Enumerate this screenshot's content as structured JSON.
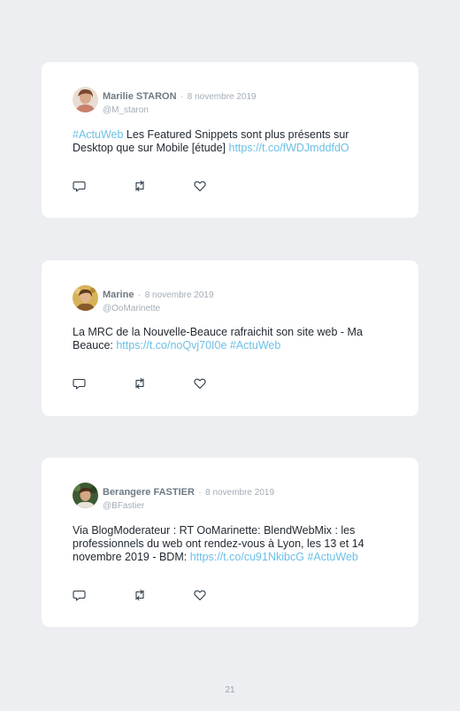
{
  "tweets": [
    {
      "name": "Marilie STARON",
      "separator": "·",
      "date": "8 novembre 2019",
      "handle": "@M_staron",
      "hashtag_lead": "#ActuWeb",
      "text_a": " Les Featured Snippets sont plus présents sur Desktop que sur Mobile [étude] ",
      "link": "https://t.co/fWDJmddfdO",
      "avatar_color": "#c98f78"
    },
    {
      "name": "Marine",
      "separator": "·",
      "date": "8 novembre 2019",
      "handle": "@OoMarinette",
      "text_a": "La MRC de la Nouvelle-Beauce rafraichit son site web - Ma Beauce: ",
      "link": "https://t.co/noQvj70I0e",
      "hashtag_trail": " #ActuWeb",
      "avatar_color": "#c7a04a"
    },
    {
      "name": "Berangere FASTIER",
      "separator": "·",
      "date": "8 novembre 2019",
      "handle": "@BFastier",
      "text_a": "Via BlogModerateur : RT OoMarinette: BlendWebMix : les professionnels du web ont rendez-vous à Lyon, les 13 et 14 novembre 2019 - BDM: ",
      "link": "https://t.co/cu91NkibcG",
      "hashtag_trail": " #ActuWeb",
      "avatar_color": "#3f5a34"
    }
  ],
  "icons": [
    "reply-icon",
    "retweet-icon",
    "like-icon"
  ],
  "colors": {
    "link": "#6cc0e6",
    "card": "#ffffff",
    "background": "#eceef1"
  },
  "page_number": "21"
}
